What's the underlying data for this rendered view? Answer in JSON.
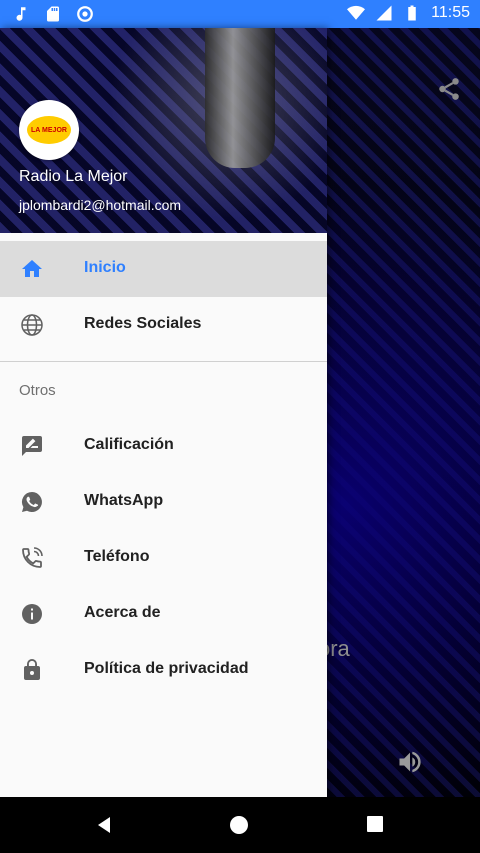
{
  "status_bar": {
    "time": "11:55",
    "icons": [
      "music-note-icon",
      "sd-card-icon",
      "circle-icon",
      "wifi-icon",
      "signal-icon",
      "battery-icon"
    ]
  },
  "background": {
    "text": "ora",
    "share_icon": "share-icon",
    "volume_icon": "volume-icon"
  },
  "drawer": {
    "header": {
      "station_name": "Radio La Mejor",
      "email": "jplombardi2@hotmail.com",
      "logo_text": "LA MEJOR"
    },
    "menu_items": [
      {
        "label": "Inicio",
        "icon": "home-icon",
        "active": true
      },
      {
        "label": "Redes Sociales",
        "icon": "globe-icon",
        "active": false
      }
    ],
    "section_title": "Otros",
    "other_items": [
      {
        "label": "Calificación",
        "icon": "rate-review-icon"
      },
      {
        "label": "WhatsApp",
        "icon": "whatsapp-icon"
      },
      {
        "label": "Teléfono",
        "icon": "phone-icon"
      },
      {
        "label": "Acerca de",
        "icon": "info-icon"
      },
      {
        "label": "Política de privacidad",
        "icon": "lock-icon"
      }
    ]
  },
  "nav_bar": {
    "buttons": [
      "back-icon",
      "home-nav-icon",
      "recents-icon"
    ]
  },
  "colors": {
    "status_bar": "#2f80ff",
    "active_text": "#2f80ff",
    "drawer_background": "#fafafa",
    "active_background": "#dcdcdc"
  }
}
